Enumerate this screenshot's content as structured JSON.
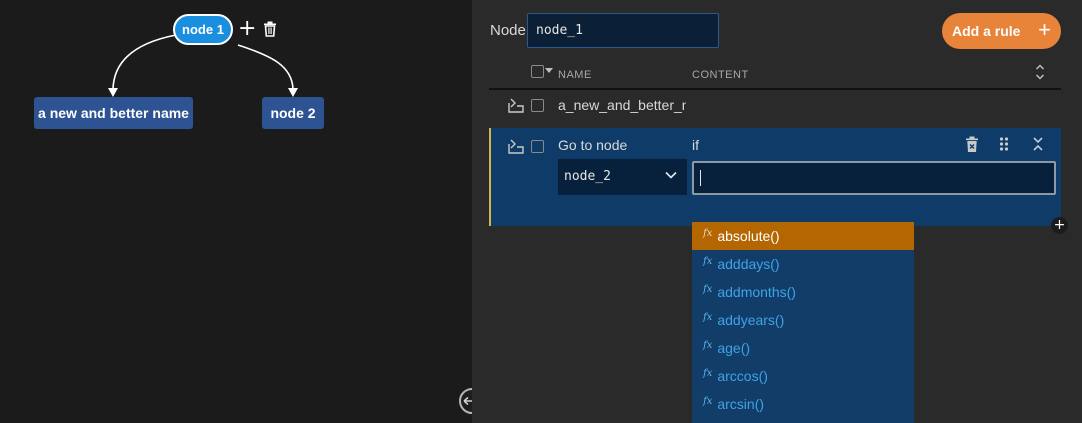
{
  "graph": {
    "root_node": "node 1",
    "children": [
      "a new and better name",
      "node 2"
    ]
  },
  "panel": {
    "node_label": "Node",
    "node_name_value": "node_1",
    "add_rule_label": "Add a rule",
    "columns": {
      "name": "NAME",
      "content": "CONTENT"
    }
  },
  "rules": [
    {
      "name": "a_new_and_better_name"
    },
    {
      "title": "Go to node",
      "condition_label": "if",
      "target": "node_2",
      "condition_value": ""
    }
  ],
  "autocomplete": {
    "fx_symbol": "fx",
    "items": [
      "absolute()",
      "adddays()",
      "addmonths()",
      "addyears()",
      "age()",
      "arccos()",
      "arcsin()"
    ],
    "active_index": 0
  },
  "colors": {
    "accent": "#e8843a",
    "selected_row": "#0f3b68",
    "root_node": "#1a8fe0",
    "child_node": "#2d5393",
    "active_suggestion": "#b46600"
  }
}
